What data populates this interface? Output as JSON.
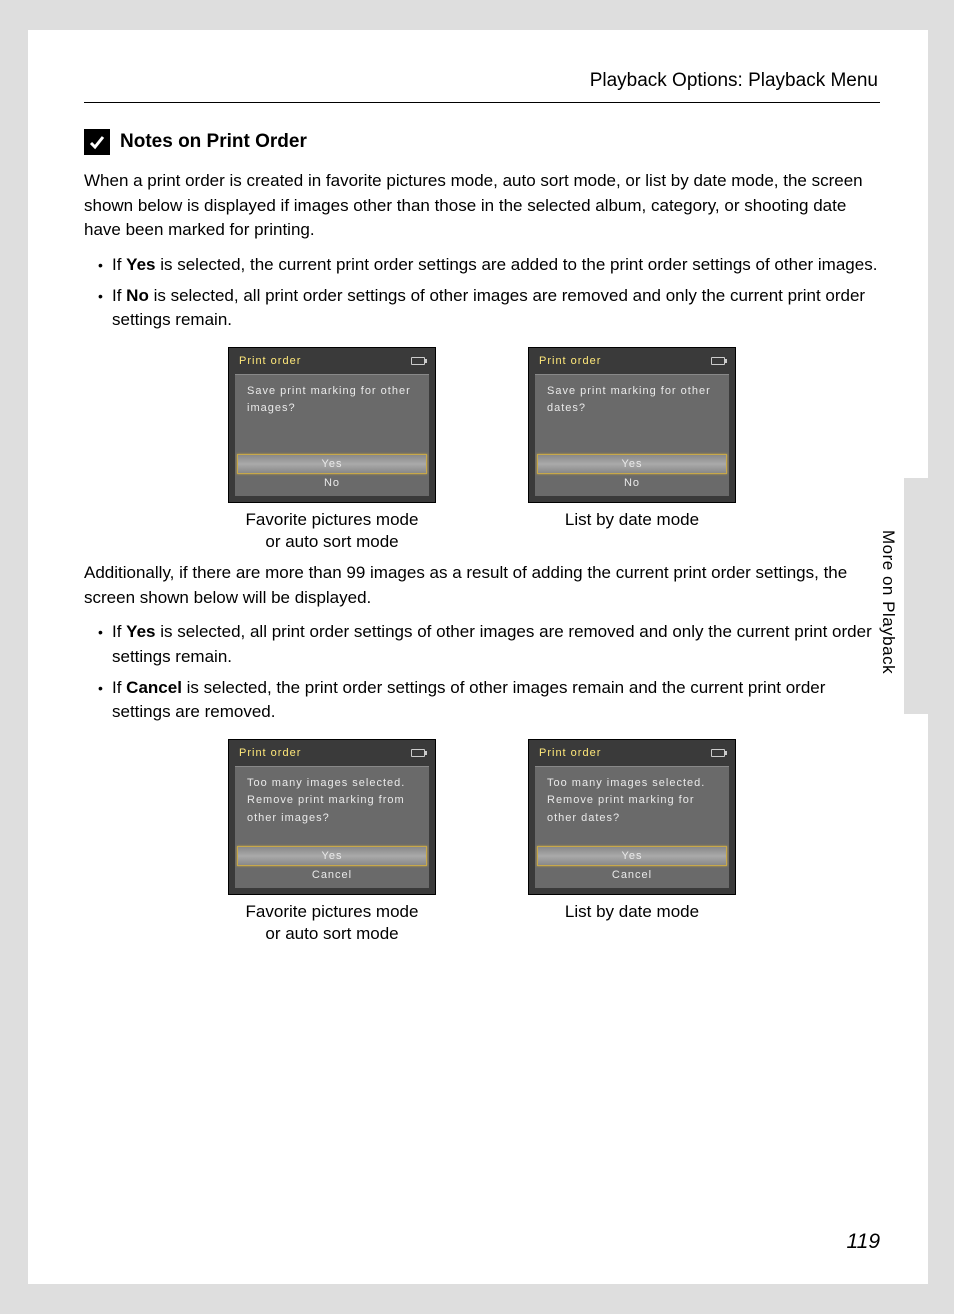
{
  "header": "Playback Options: Playback Menu",
  "title": "Notes on Print Order",
  "intro": "When a print order is created in favorite pictures mode, auto sort mode, or list by date mode, the screen shown below is displayed if images other than those in the selected album, category, or shooting date have been marked for printing.",
  "bullets1": [
    {
      "bold": "Yes",
      "pre": "If ",
      "post": " is selected, the current print order settings are added to the print order settings of other images."
    },
    {
      "bold": "No",
      "pre": "If ",
      "post": " is selected, all print order settings of other images are removed and only the current print order settings remain."
    }
  ],
  "row1": {
    "left": {
      "title": "Print order",
      "prompt": "Save print marking for other images?",
      "opt1": "Yes",
      "opt2": "No",
      "caption_l1": "Favorite pictures mode",
      "caption_l2": "or auto sort mode"
    },
    "right": {
      "title": "Print order",
      "prompt": "Save print marking for other dates?",
      "opt1": "Yes",
      "opt2": "No",
      "caption_l1": "List by date mode"
    }
  },
  "para2": "Additionally, if there are more than 99 images as a result of adding the current print order settings, the screen shown below will be displayed.",
  "bullets2": [
    {
      "bold": "Yes",
      "pre": "If ",
      "post": " is selected, all print order settings of other images are removed and only the current print order settings remain."
    },
    {
      "bold": "Cancel",
      "pre": "If ",
      "post": " is selected, the print order settings of other images remain and the current print order settings are removed."
    }
  ],
  "row2": {
    "left": {
      "title": "Print order",
      "prompt": "Too many images selected. Remove print marking from other images?",
      "opt1": "Yes",
      "opt2": "Cancel",
      "caption_l1": "Favorite pictures mode",
      "caption_l2": "or auto sort mode"
    },
    "right": {
      "title": "Print order",
      "prompt": "Too many images selected. Remove print marking for other dates?",
      "opt1": "Yes",
      "opt2": "Cancel",
      "caption_l1": "List by date mode"
    }
  },
  "side_label": "More on Playback",
  "page_number": "119"
}
